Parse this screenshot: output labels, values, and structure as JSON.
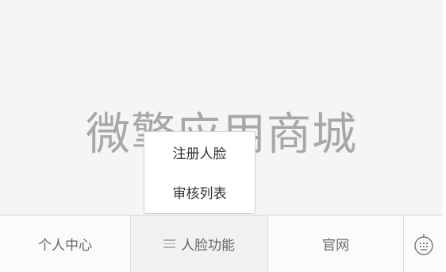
{
  "watermark": {
    "text": "微擎应用商城"
  },
  "popup_menu": {
    "items": [
      {
        "label": "注册人脸"
      },
      {
        "label": "审核列表"
      }
    ]
  },
  "tabbar": {
    "tabs": [
      {
        "label": "个人中心"
      },
      {
        "label": "人脸功能",
        "icon": "menu-icon"
      },
      {
        "label": "官网"
      },
      {
        "icon": "keyboard-icon"
      }
    ]
  },
  "colors": {
    "background": "#f5f5f5",
    "watermark": "#a7a7a7",
    "active_tab": "#f1f1ef",
    "tab_text": "#666666"
  }
}
